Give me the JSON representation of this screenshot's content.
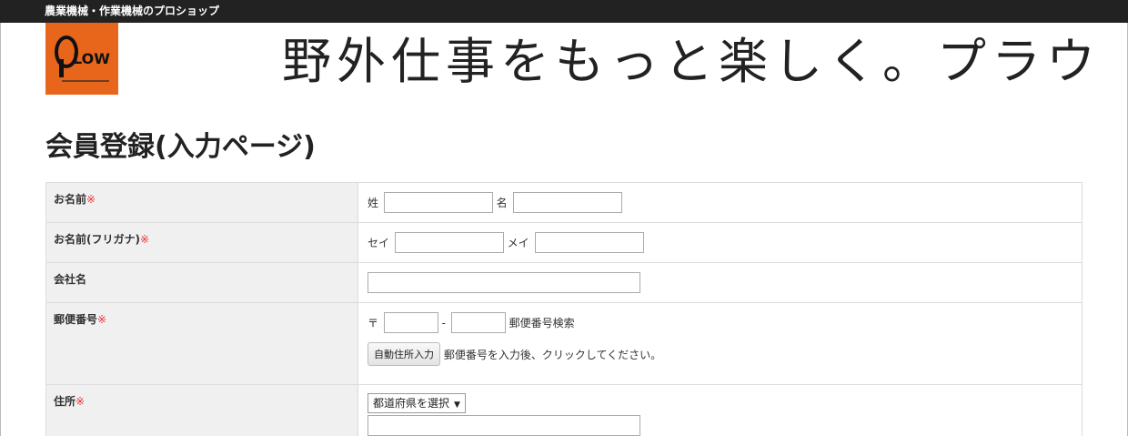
{
  "header": {
    "shop_name": "農業機械・作業機械のプロショップ",
    "logo_text": "LOW",
    "tagline": "野外仕事をもっと楽しく。プラウ"
  },
  "page": {
    "title": "会員登録(入力ページ)"
  },
  "form": {
    "required_mark": "※",
    "name": {
      "label": "お名前",
      "sei_label": "姓",
      "mei_label": "名",
      "sei_value": "",
      "mei_value": ""
    },
    "kana": {
      "label": "お名前(フリガナ)",
      "sei_label": "セイ",
      "mei_label": "メイ",
      "sei_value": "",
      "mei_value": ""
    },
    "company": {
      "label": "会社名",
      "value": ""
    },
    "postal": {
      "label": "郵便番号",
      "prefix": "〒",
      "separator": "-",
      "search_link": "郵便番号検索",
      "zip1": "",
      "zip2": "",
      "auto_button": "自動住所入力",
      "hint": "郵便番号を入力後、クリックしてください。"
    },
    "address": {
      "label": "住所",
      "prefecture_placeholder": "都道府県を選択",
      "city_value": ""
    }
  }
}
